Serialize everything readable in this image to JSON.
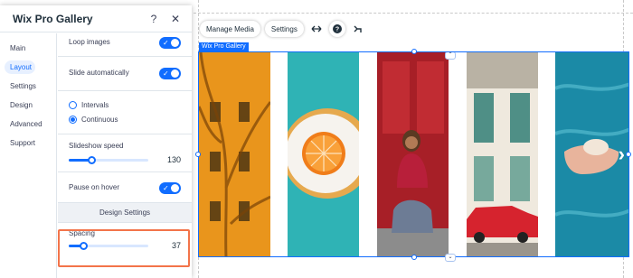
{
  "panel": {
    "title": "Wix Pro Gallery",
    "help_icon": "?",
    "close_icon": "✕",
    "nav": [
      {
        "label": "Main",
        "active": false
      },
      {
        "label": "Layout",
        "active": true
      },
      {
        "label": "Settings",
        "active": false
      },
      {
        "label": "Design",
        "active": false
      },
      {
        "label": "Advanced",
        "active": false
      },
      {
        "label": "Support",
        "active": false
      }
    ],
    "loop_images_label": "Loop images",
    "slide_automatically_label": "Slide automatically",
    "slide_mode": {
      "options": [
        "Intervals",
        "Continuous"
      ],
      "selected": "Continuous"
    },
    "slideshow_speed": {
      "label": "Slideshow speed",
      "value": "130",
      "fraction": 0.28
    },
    "pause_on_hover_label": "Pause on hover",
    "design_settings_header": "Design Settings",
    "spacing": {
      "label": "Spacing",
      "value": "37",
      "fraction": 0.18
    }
  },
  "toolbar": {
    "manage_media": "Manage Media",
    "settings": "Settings"
  },
  "gallery": {
    "tag": "Wix Pro Gallery"
  },
  "colors": {
    "accent": "#116dff",
    "highlight": "#f3744a"
  }
}
